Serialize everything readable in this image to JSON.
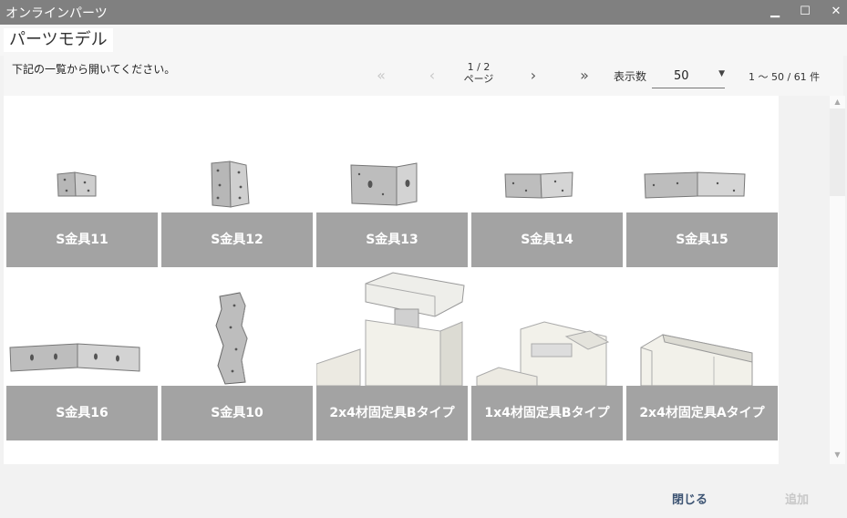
{
  "window": {
    "title": "オンラインパーツ",
    "minimize_icon": "minimize-icon",
    "maximize_icon": "maximize-icon",
    "close_icon": "close-icon"
  },
  "heading": "パーツモデル",
  "instruction": "下記の一覧から開いてください。",
  "pagination": {
    "first_icon": "«",
    "prev_icon": "‹",
    "page": "1 / 2",
    "page_unit": "ページ",
    "next_icon": "›",
    "last_icon": "»",
    "per_page_label": "表示数",
    "per_page_value": "50",
    "count": "1 ～ 50 / 61 件"
  },
  "items": [
    {
      "label": "S金具11"
    },
    {
      "label": "S金具12"
    },
    {
      "label": "S金具13"
    },
    {
      "label": "S金具14"
    },
    {
      "label": "S金具15"
    },
    {
      "label": "S金具16"
    },
    {
      "label": "S金具10"
    },
    {
      "label": "2x4材固定具Bタイプ"
    },
    {
      "label": "1x4材固定具Bタイプ"
    },
    {
      "label": "2x4材固定具Aタイプ"
    }
  ],
  "footer": {
    "close_label": "閉じる",
    "add_label": "追加"
  },
  "colors": {
    "titlebar": "#808080",
    "card_label": "#969696",
    "accent": "#3d5473",
    "disabled": "#c8c8c8"
  }
}
